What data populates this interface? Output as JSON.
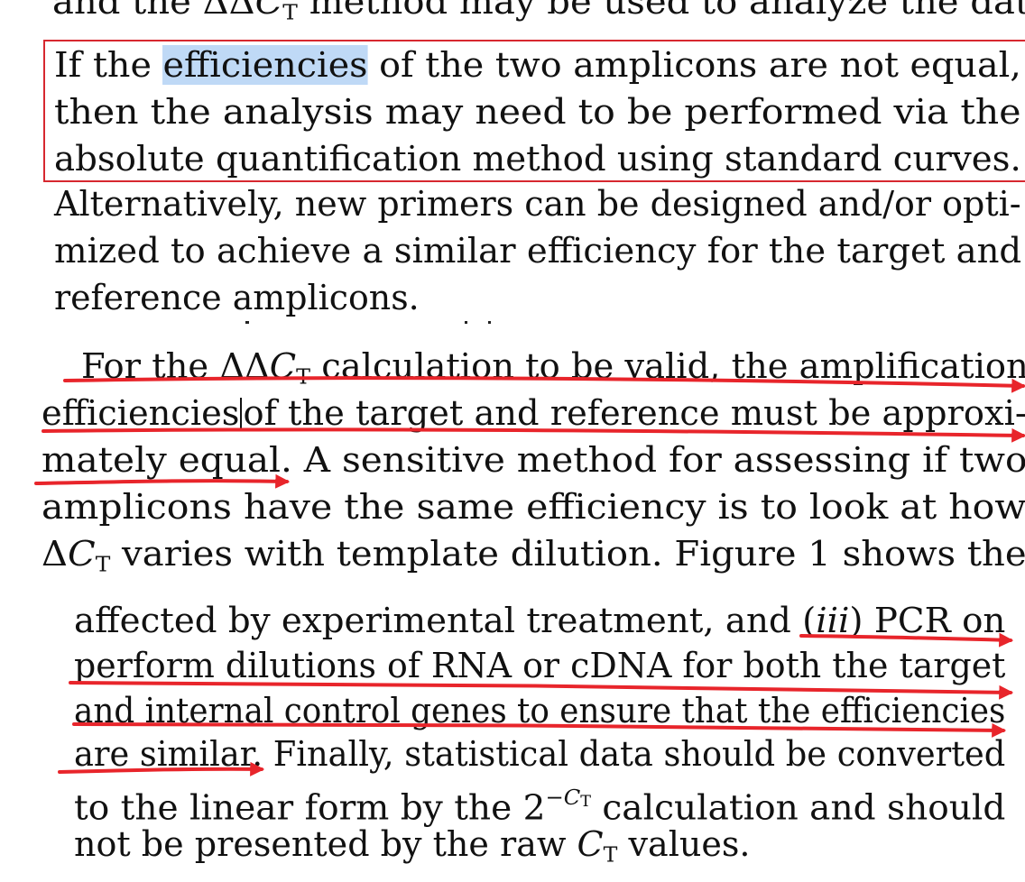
{
  "colors": {
    "annotation": "#e8252b",
    "highlight": "#b9d3f3",
    "text": "#111111"
  },
  "block1": {
    "line0": {
      "a": "and the ΔΔ",
      "b": "C",
      "c": "T",
      "d": " method may be used to analyze the data."
    },
    "line1": {
      "a": "If the ",
      "hl": "efficiencies",
      "b": " of the two amplicons are not equal,"
    },
    "line2": "then the analysis may need to be performed via the",
    "line3": "absolute quantification method using standard curves.",
    "line4": "Alternatively, new primers can be designed and/or opti-",
    "line5": "mized to achieve a similar efficiency for the target and",
    "line6": "reference amplicons."
  },
  "block2": {
    "line1": {
      "a": "For the ΔΔ",
      "b": "C",
      "c": "T",
      "d": " calculation to be valid, the amplification"
    },
    "line2": {
      "a": "efficiencies",
      "b": "of the target and reference must be approxi-"
    },
    "line3": "mately equal. A sensitive method for assessing if two",
    "line4": "amplicons have the same efficiency is to look at how",
    "line5": {
      "a": "Δ",
      "b": "C",
      "c": "T",
      "d": " varies with template dilution. Figure 1 shows the"
    }
  },
  "block3": {
    "line1": {
      "a": "affected by experimental treatment, and (",
      "b": "iii",
      "c": ") PCR on"
    },
    "line2": "perform dilutions of RNA or cDNA for both the target",
    "line3": "and internal control genes to ensure that the efficiencies",
    "line4": "are similar. Finally, statistical data should be converted",
    "line5": {
      "a": "to the linear form by the 2",
      "sup1": "−C",
      "sup2": "T",
      "b": " calculation and should"
    },
    "line6": {
      "a": "not be presented by the raw ",
      "b": "C",
      "c": "T",
      "d": " values."
    }
  }
}
